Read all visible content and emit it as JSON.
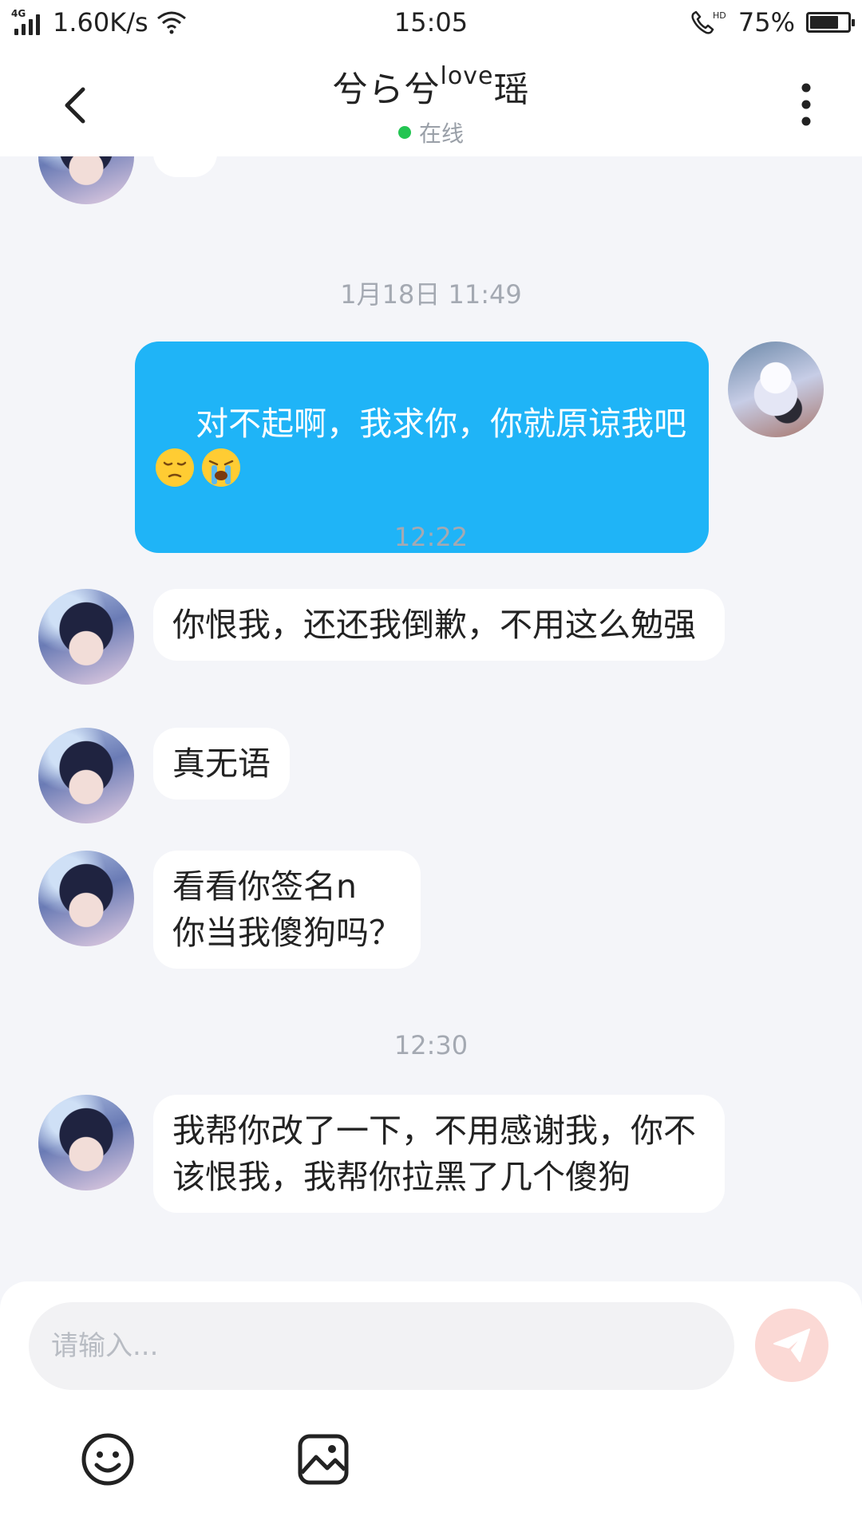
{
  "status_bar": {
    "network_tag": "4G",
    "speed": "1.60K/s",
    "time": "15:05",
    "hd_tag": "HD",
    "battery": "75%",
    "battery_level": 0.75
  },
  "header": {
    "title_main_1": "兮ら兮",
    "title_sup": "love",
    "title_main_2": "瑶",
    "online_status": "在线",
    "online_color": "#23c552"
  },
  "chat": {
    "messages": [
      {
        "type": "timestamp",
        "text": "1月18日 11:49"
      },
      {
        "type": "sent",
        "text": "对不起啊，我求你，你就原谅我吧",
        "emojis": [
          "pensive-face-emoji",
          "crying-face-emoji"
        ]
      },
      {
        "type": "timestamp",
        "text": "12:22"
      },
      {
        "type": "received",
        "text": "你恨我，还还我倒歉，不用这么勉强"
      },
      {
        "type": "received",
        "text": "真无语"
      },
      {
        "type": "received",
        "text": "看看你签名n\n你当我傻狗吗？"
      },
      {
        "type": "timestamp",
        "text": "12:30"
      },
      {
        "type": "received",
        "text": "我帮你改了一下，不用感谢我，你不该恨我，我帮你拉黑了几个傻狗"
      }
    ]
  },
  "composer": {
    "placeholder": "请输入...",
    "value": "",
    "send_icon": "send-icon",
    "tools": [
      "emoji-icon",
      "image-icon"
    ]
  },
  "colors": {
    "sent_bubble": "#1fb4f7",
    "received_bubble": "#ffffff",
    "background": "#f4f5f9",
    "send_button": "#fbd9d5"
  }
}
